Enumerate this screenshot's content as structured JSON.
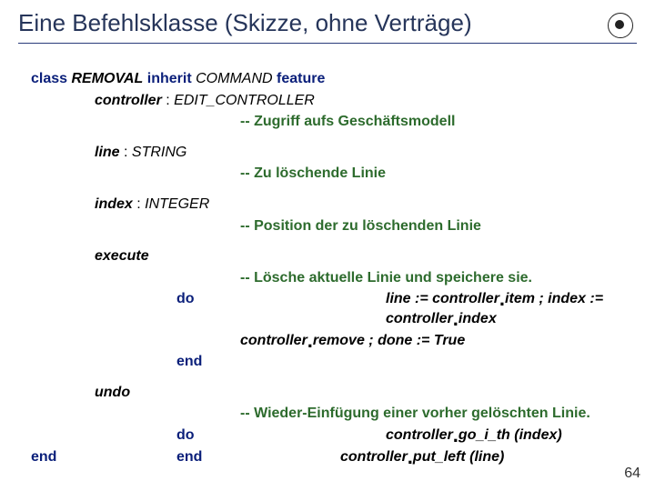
{
  "title": "Eine Befehlsklasse (Skizze, ohne Verträge)",
  "kw": {
    "class": "class",
    "inherit": "inherit",
    "feature": "feature",
    "do": "do",
    "end": "end"
  },
  "decl": {
    "removal": "REMOVAL",
    "command": "COMMAND",
    "controller_name": "controller",
    "controller_type": "EDIT_CONTROLLER",
    "controller_cmt": "-- Zugriff aufs Geschäftsmodell",
    "line_name": "line",
    "line_type": "STRING",
    "line_cmt": "-- Zu löschende Linie",
    "index_name": "index",
    "index_type": "INTEGER",
    "index_cmt": "-- Position der zu löschenden Linie",
    "colon": " : "
  },
  "exec": {
    "name": "execute",
    "cmt": "-- Lösche aktuelle Linie und speichere sie.",
    "l1a": "line := controller",
    "l1b": "item ; index := controller",
    "l1c": "index",
    "l2a": "controller",
    "l2b": "remove   ; done := True"
  },
  "undo": {
    "name": "undo",
    "cmt": "-- Wieder-Einfügung einer vorher gelöschten Linie.",
    "l1a": "controller",
    "l1b": "go_i_th (index)",
    "l2a": "controller",
    "l2b": "put_left (line)"
  },
  "pagenum": "64"
}
